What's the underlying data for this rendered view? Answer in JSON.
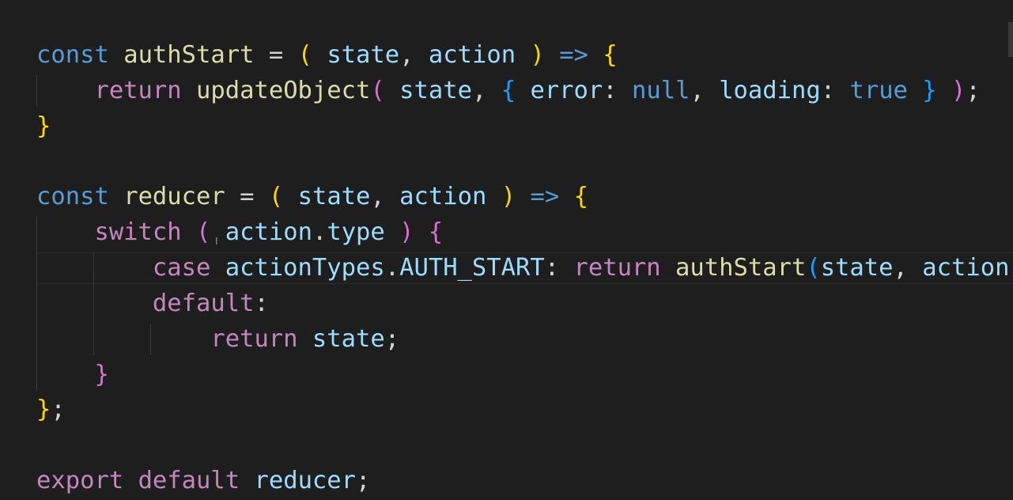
{
  "editor": {
    "lines": [
      {
        "tokens": [
          {
            "t": "const",
            "c": "kw"
          },
          {
            "t": " ",
            "c": "plain"
          },
          {
            "t": "authStart",
            "c": "fn"
          },
          {
            "t": " = ",
            "c": "plain"
          },
          {
            "t": "(",
            "c": "paren1"
          },
          {
            "t": " ",
            "c": "plain"
          },
          {
            "t": "state",
            "c": "var"
          },
          {
            "t": ", ",
            "c": "plain"
          },
          {
            "t": "action",
            "c": "var"
          },
          {
            "t": " ",
            "c": "plain"
          },
          {
            "t": ")",
            "c": "paren1"
          },
          {
            "t": " ",
            "c": "plain"
          },
          {
            "t": "=>",
            "c": "kw"
          },
          {
            "t": " ",
            "c": "plain"
          },
          {
            "t": "{",
            "c": "paren1"
          }
        ]
      },
      {
        "tokens": [
          {
            "t": "    ",
            "c": "plain"
          },
          {
            "t": "return",
            "c": "ctl"
          },
          {
            "t": " ",
            "c": "plain"
          },
          {
            "t": "updateObject",
            "c": "fn"
          },
          {
            "t": "(",
            "c": "paren2"
          },
          {
            "t": " ",
            "c": "plain"
          },
          {
            "t": "state",
            "c": "var"
          },
          {
            "t": ", ",
            "c": "plain"
          },
          {
            "t": "{",
            "c": "paren3"
          },
          {
            "t": " ",
            "c": "plain"
          },
          {
            "t": "error",
            "c": "var"
          },
          {
            "t": ": ",
            "c": "plain"
          },
          {
            "t": "null",
            "c": "kw"
          },
          {
            "t": ", ",
            "c": "plain"
          },
          {
            "t": "loading",
            "c": "var"
          },
          {
            "t": ": ",
            "c": "plain"
          },
          {
            "t": "true",
            "c": "kw"
          },
          {
            "t": " ",
            "c": "plain"
          },
          {
            "t": "}",
            "c": "paren3"
          },
          {
            "t": " ",
            "c": "plain"
          },
          {
            "t": ")",
            "c": "paren2"
          },
          {
            "t": ";",
            "c": "plain"
          }
        ]
      },
      {
        "tokens": [
          {
            "t": "}",
            "c": "paren1"
          }
        ]
      },
      {
        "tokens": []
      },
      {
        "tokens": [
          {
            "t": "const",
            "c": "kw"
          },
          {
            "t": " ",
            "c": "plain"
          },
          {
            "t": "reducer",
            "c": "fn"
          },
          {
            "t": " = ",
            "c": "plain"
          },
          {
            "t": "(",
            "c": "paren1"
          },
          {
            "t": " ",
            "c": "plain"
          },
          {
            "t": "state",
            "c": "var"
          },
          {
            "t": ", ",
            "c": "plain"
          },
          {
            "t": "action",
            "c": "var"
          },
          {
            "t": " ",
            "c": "plain"
          },
          {
            "t": ")",
            "c": "paren1"
          },
          {
            "t": " ",
            "c": "plain"
          },
          {
            "t": "=>",
            "c": "kw"
          },
          {
            "t": " ",
            "c": "plain"
          },
          {
            "t": "{",
            "c": "paren1"
          }
        ]
      },
      {
        "tokens": [
          {
            "t": "    ",
            "c": "plain"
          },
          {
            "t": "switch",
            "c": "ctl"
          },
          {
            "t": " ",
            "c": "plain"
          },
          {
            "t": "(",
            "c": "paren2"
          },
          {
            "t": " ",
            "c": "plain"
          },
          {
            "t": "action",
            "c": "var"
          },
          {
            "t": ".",
            "c": "plain"
          },
          {
            "t": "type",
            "c": "var"
          },
          {
            "t": " ",
            "c": "plain"
          },
          {
            "t": ")",
            "c": "paren2"
          },
          {
            "t": " ",
            "c": "plain"
          },
          {
            "t": "{",
            "c": "paren2"
          }
        ]
      },
      {
        "tokens": [
          {
            "t": "        ",
            "c": "plain"
          },
          {
            "t": "case",
            "c": "ctl"
          },
          {
            "t": " ",
            "c": "plain"
          },
          {
            "t": "actionTypes",
            "c": "var"
          },
          {
            "t": ".",
            "c": "plain"
          },
          {
            "t": "AUTH_START",
            "c": "enum"
          },
          {
            "t": ": ",
            "c": "plain"
          },
          {
            "t": "return",
            "c": "ctl"
          },
          {
            "t": " ",
            "c": "plain"
          },
          {
            "t": "authStart",
            "c": "fn"
          },
          {
            "t": "(",
            "c": "paren3"
          },
          {
            "t": "state",
            "c": "var"
          },
          {
            "t": ", ",
            "c": "plain"
          },
          {
            "t": "action",
            "c": "var"
          },
          {
            "t": ")",
            "c": "paren3"
          },
          {
            "t": ";",
            "c": "plain"
          }
        ]
      },
      {
        "tokens": [
          {
            "t": "        ",
            "c": "plain"
          },
          {
            "t": "default",
            "c": "ctl"
          },
          {
            "t": ":",
            "c": "plain"
          }
        ]
      },
      {
        "tokens": [
          {
            "t": "            ",
            "c": "plain"
          },
          {
            "t": "return",
            "c": "ctl"
          },
          {
            "t": " ",
            "c": "plain"
          },
          {
            "t": "state",
            "c": "var"
          },
          {
            "t": ";",
            "c": "plain"
          }
        ]
      },
      {
        "tokens": [
          {
            "t": "    ",
            "c": "plain"
          },
          {
            "t": "}",
            "c": "paren2"
          }
        ]
      },
      {
        "tokens": [
          {
            "t": "}",
            "c": "paren1"
          },
          {
            "t": ";",
            "c": "plain"
          }
        ]
      },
      {
        "tokens": []
      },
      {
        "tokens": [
          {
            "t": "export",
            "c": "ctl"
          },
          {
            "t": " ",
            "c": "plain"
          },
          {
            "t": "default",
            "c": "ctl"
          },
          {
            "t": " ",
            "c": "plain"
          },
          {
            "t": "reducer",
            "c": "var"
          },
          {
            "t": ";",
            "c": "plain"
          }
        ]
      }
    ]
  },
  "colors": {
    "background": "#1e1e1e",
    "keyword": "#569cd6",
    "control": "#c586c0",
    "function": "#dcdcaa",
    "variable": "#9cdcfe",
    "bracket_level1": "#ffd700",
    "bracket_level2": "#da70d6",
    "bracket_level3": "#179fff"
  },
  "cursor": {
    "icon": "text-cursor-icon"
  }
}
